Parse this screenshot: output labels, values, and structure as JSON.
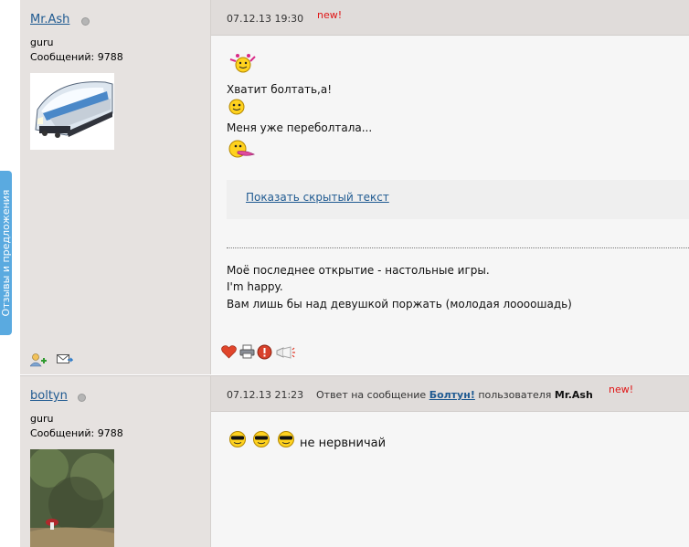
{
  "sidebar_tab": {
    "label": "Отзывы и предложения"
  },
  "posts": [
    {
      "author": {
        "name": "Mr.Ash",
        "rank": "guru",
        "messages": "Сообщений: 9788"
      },
      "date": "07.12.13 19:30",
      "new_label": "new!",
      "body": {
        "line1": "Хватит болтать,а!",
        "line2": "Меня уже переболтала...",
        "hidden_link": "Показать скрытый текст"
      },
      "signature": {
        "line1": "Моё последнее открытие - настольные игры.",
        "line2": "I'm happy.",
        "line3": "Вам лишь бы над девушкой поржать (молодая лоооошадь)"
      }
    },
    {
      "author": {
        "name": "boltyn",
        "rank": "guru",
        "messages": "Сообщений: 9788"
      },
      "date": "07.12.13 21:23",
      "reply_prefix": "Ответ на сообщение",
      "reply_link": "Болтун!",
      "reply_mid": "пользователя",
      "reply_user": "Mr.Ash",
      "new_label": "new!",
      "body": {
        "line1": "не нервничай"
      }
    }
  ],
  "icons": [
    "add-friend-icon",
    "send-message-icon",
    "like-heart-icon",
    "print-icon",
    "report-icon",
    "quote-icon",
    "smiley-icon",
    "sunglasses-smiley-icon"
  ]
}
